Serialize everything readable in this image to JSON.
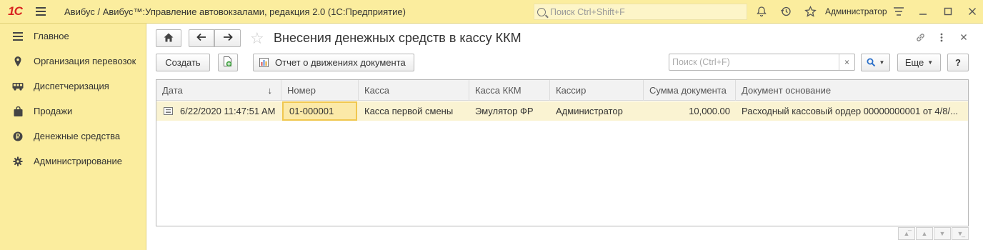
{
  "app": {
    "logo": "1С",
    "title": "Авибус / Авибус™:Управление автовокзалами, редакция 2.0  (1С:Предприятие)",
    "search_placeholder": "Поиск Ctrl+Shift+F",
    "user": "Администратор"
  },
  "sidebar": {
    "items": [
      {
        "label": "Главное",
        "icon": "menu-lines-icon"
      },
      {
        "label": "Организация перевозок",
        "icon": "map-pin-icon"
      },
      {
        "label": "Диспетчеризация",
        "icon": "bus-icon"
      },
      {
        "label": "Продажи",
        "icon": "shopping-bag-icon"
      },
      {
        "label": "Денежные средства",
        "icon": "ruble-coin-icon"
      },
      {
        "label": "Администрирование",
        "icon": "gear-icon"
      }
    ]
  },
  "form": {
    "title": "Внесения денежных средств в кассу ККМ",
    "create_label": "Создать",
    "report_label": "Отчет о движениях документа",
    "search_placeholder": "Поиск (Ctrl+F)",
    "more_label": "Еще",
    "help_label": "?"
  },
  "table": {
    "columns": [
      "Дата",
      "Номер",
      "Касса",
      "Касса ККМ",
      "Кассир",
      "Сумма документа",
      "Документ основание"
    ],
    "sort_indicator": "↓",
    "rows": [
      {
        "date": "6/22/2020 11:47:51 AM",
        "number": "01-000001",
        "cash_desk": "Касса первой смены",
        "kkm": "Эмулятор ФР",
        "cashier": "Администратор",
        "amount": "10,000.00",
        "basis": "Расходный кассовый ордер 00000000001 от 4/8/..."
      }
    ]
  },
  "colors": {
    "accent_yellow": "#fbed9e",
    "row_highlight": "#faf3d2",
    "selected_cell_border": "#f0c74f",
    "logo_red": "#d8231f"
  }
}
